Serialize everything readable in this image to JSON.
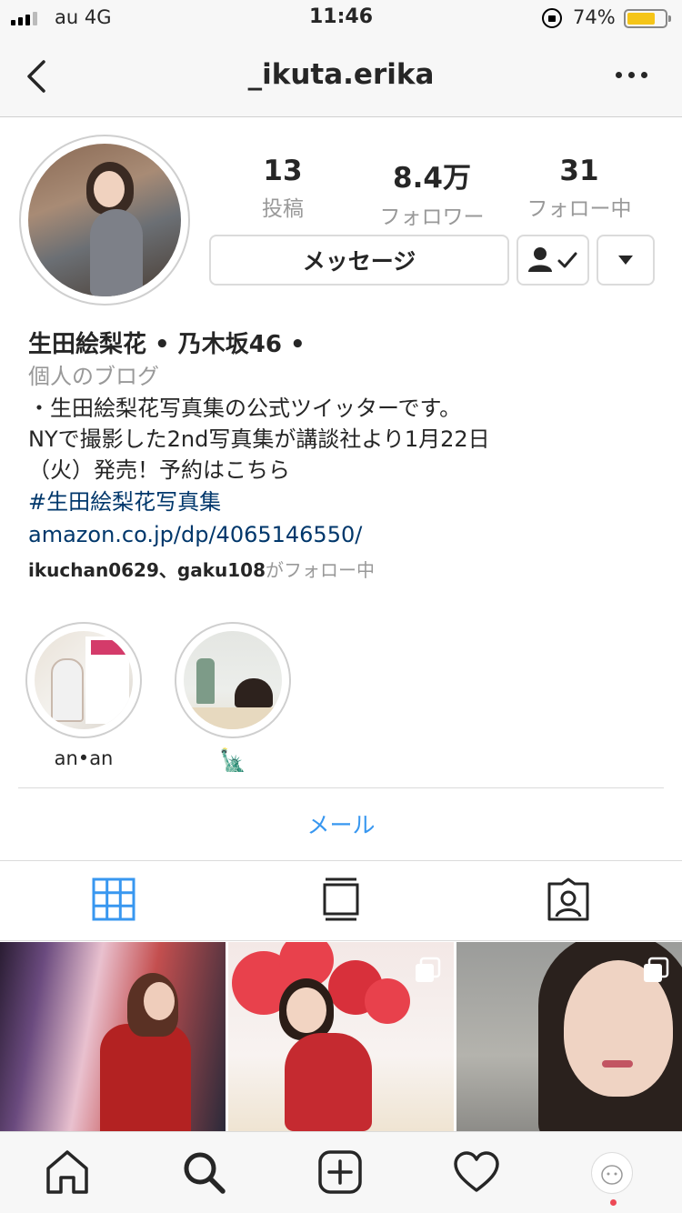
{
  "status_bar": {
    "carrier": "au 4G",
    "time": "11:46",
    "battery_pct": "74%"
  },
  "nav": {
    "username": "_ikuta.erika"
  },
  "stats": [
    {
      "value": "13",
      "label": "投稿"
    },
    {
      "value": "8.4万",
      "label": "フォロワー"
    },
    {
      "value": "31",
      "label": "フォロー中"
    }
  ],
  "buttons": {
    "message": "メッセージ"
  },
  "bio": {
    "name": "生田絵梨花 • 乃木坂46 •",
    "category": "個人のブログ",
    "lines": [
      "・生田絵梨花写真集の公式ツイッターです。",
      "NYで撮影した2nd写真集が講談社より1月22日",
      "（火）発売！予約はこちら"
    ],
    "hashtag": "#生田絵梨花写真集",
    "link": "amazon.co.jp/dp/4065146550/",
    "followed_by_users": "ikuchan0629、gaku108",
    "followed_by_suffix": "がフォロー中"
  },
  "highlights": [
    {
      "label": "an•an"
    },
    {
      "label": "🗽"
    }
  ],
  "contact": {
    "email": "メール"
  },
  "tabs": [
    {
      "icon": "grid-icon",
      "active": true
    },
    {
      "icon": "feed-icon",
      "active": false
    },
    {
      "icon": "tagged-icon",
      "active": false
    }
  ],
  "bottom_nav": [
    {
      "icon": "home-icon"
    },
    {
      "icon": "search-icon"
    },
    {
      "icon": "add-post-icon"
    },
    {
      "icon": "heart-icon"
    },
    {
      "icon": "profile-avatar"
    }
  ],
  "colors": {
    "link": "#00376b",
    "email": "#3897f0",
    "active_tab": "#3897f0",
    "battery": "#f5c518",
    "notification_dot": "#ed4956"
  }
}
